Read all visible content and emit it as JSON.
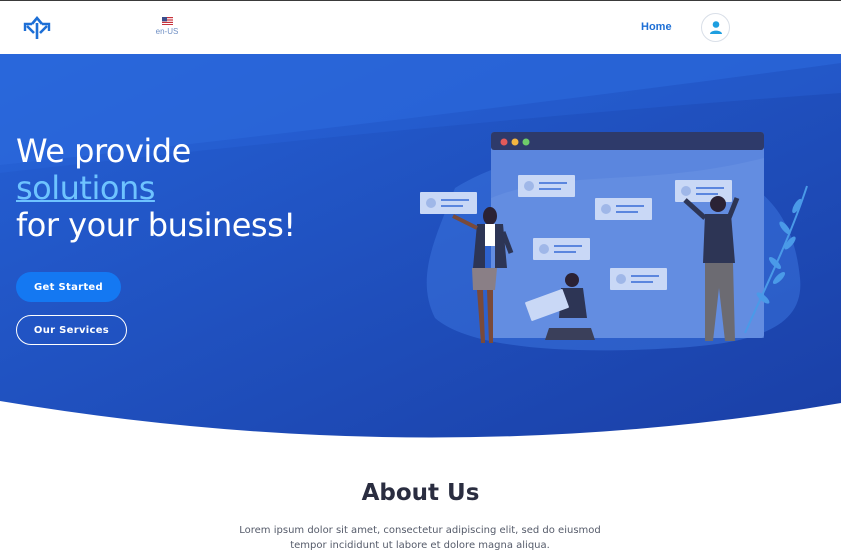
{
  "header": {
    "logo_icon": "split-arrows-icon",
    "language": {
      "flag_icon": "us-flag-icon",
      "label": "en-US"
    },
    "nav": {
      "home_label": "Home"
    },
    "user_icon": "user-icon"
  },
  "hero": {
    "headline_line1": "We provide",
    "headline_accent": "solutions",
    "headline_line3": "for your business!",
    "primary_button_label": "Get Started",
    "secondary_button_label": "Our Services",
    "illustration_icon": "team-dashboard-illustration"
  },
  "about": {
    "title": "About Us",
    "text": "Lorem ipsum dolor sit amet, consectetur adipiscing elit, sed do eiusmod tempor incididunt ut labore et dolore magna aliqua."
  },
  "colors": {
    "brand_blue": "#1478f2",
    "hero_dark": "#1a3fa6",
    "hero_light": "#2a64d8",
    "accent_text": "#6ec3ff",
    "heading_text": "#2a2d40"
  }
}
